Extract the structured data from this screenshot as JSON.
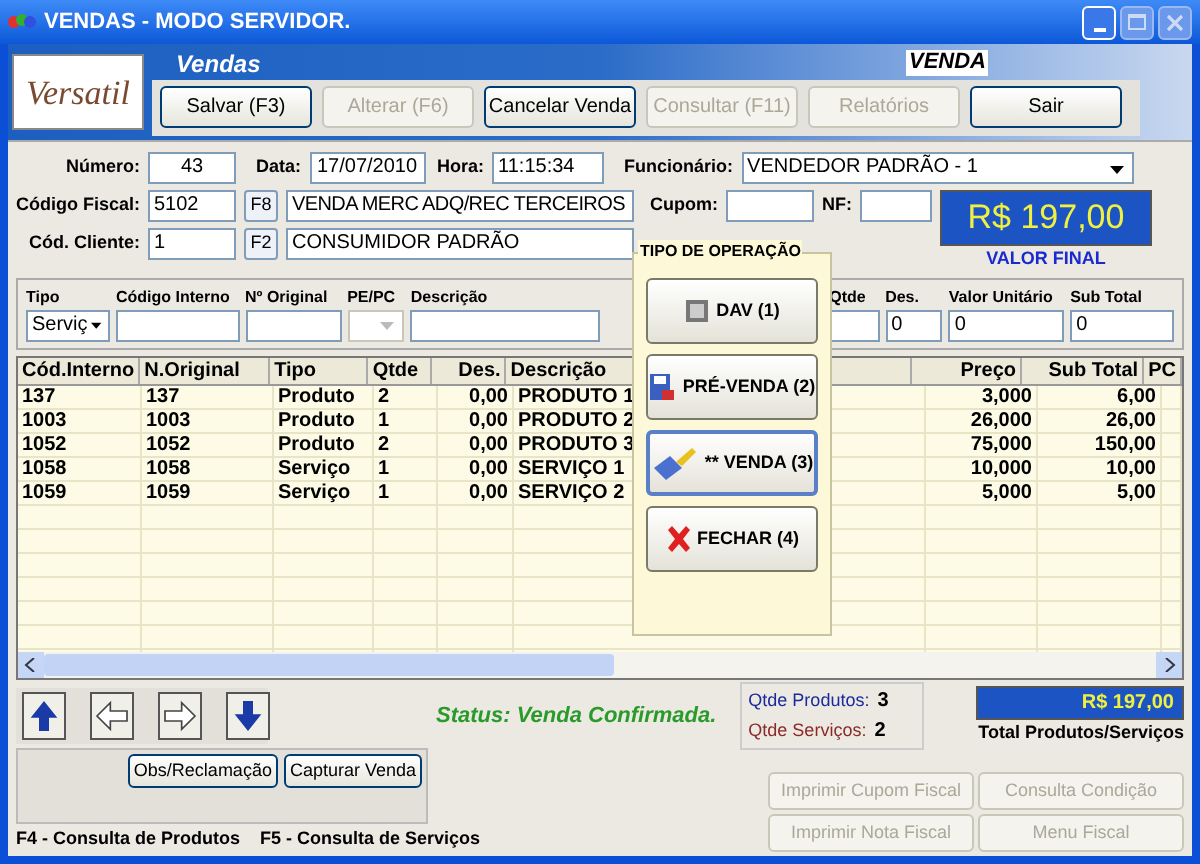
{
  "window": {
    "title": "VENDAS - MODO SERVIDOR."
  },
  "header": {
    "logo": "Versatil",
    "title": "Vendas",
    "mode": "VENDA"
  },
  "toolbar": {
    "buttons": [
      {
        "label": "Salvar (F3)",
        "disabled": false
      },
      {
        "label": "Alterar (F6)",
        "disabled": true
      },
      {
        "label": "Cancelar Venda",
        "disabled": false
      },
      {
        "label": "Consultar (F11)",
        "disabled": true
      },
      {
        "label": "Relatórios",
        "disabled": true
      },
      {
        "label": "Sair",
        "disabled": false
      }
    ]
  },
  "form": {
    "numero": {
      "label": "Número:",
      "value": "43"
    },
    "data": {
      "label": "Data:",
      "value": "17/07/2010"
    },
    "hora": {
      "label": "Hora:",
      "value": "11:15:34"
    },
    "funcionario": {
      "label": "Funcionário:",
      "value": "VENDEDOR PADRÃO - 1"
    },
    "codigo_fiscal": {
      "label": "Código Fiscal:",
      "value": "5102",
      "key": "F8",
      "description": "VENDA MERC ADQ/REC TERCEIROS"
    },
    "cupom": {
      "label": "Cupom:"
    },
    "nf": {
      "label": "NF:"
    },
    "cliente": {
      "label": "Cód. Cliente:",
      "value": "1",
      "key": "F2",
      "description": "CONSUMIDOR PADRÃO"
    },
    "valor_final": {
      "value": "R$ 197,00",
      "label": "VALOR FINAL"
    }
  },
  "entry": {
    "fields": [
      {
        "label": "Tipo",
        "value": "Serviç",
        "kind": "select",
        "disabled": false
      },
      {
        "label": "Código Interno",
        "kind": "input"
      },
      {
        "label": "Nº Original",
        "kind": "input"
      },
      {
        "label": "PE/PC",
        "kind": "select",
        "disabled": true
      },
      {
        "label": "Descrição",
        "kind": "input"
      },
      {
        "label": "Qtde",
        "kind": "input"
      },
      {
        "label": "Des.",
        "value": "0",
        "kind": "input"
      },
      {
        "label": "Valor Unitário",
        "value": "0",
        "kind": "input"
      },
      {
        "label": "Sub Total",
        "value": "0",
        "kind": "input"
      }
    ]
  },
  "table": {
    "columns": [
      "Cód.Interno",
      "N.Original",
      "Tipo",
      "Qtde",
      "Des.",
      "Descrição",
      "Preço",
      "Sub Total",
      "PC"
    ],
    "rows": [
      {
        "cells": [
          "137",
          "137",
          "Produto",
          "2",
          "0,00",
          "PRODUTO 1",
          "3,000",
          "6,00"
        ]
      },
      {
        "cells": [
          "1003",
          "1003",
          "Produto",
          "1",
          "0,00",
          "PRODUTO 2",
          "26,000",
          "26,00"
        ]
      },
      {
        "cells": [
          "1052",
          "1052",
          "Produto",
          "2",
          "0,00",
          "PRODUTO 3",
          "75,000",
          "150,00"
        ]
      },
      {
        "cells": [
          "1058",
          "1058",
          "Serviço",
          "1",
          "0,00",
          "SERVIÇO 1",
          "10,000",
          "10,00"
        ]
      },
      {
        "cells": [
          "1059",
          "1059",
          "Serviço",
          "1",
          "0,00",
          "SERVIÇO 2",
          "5,000",
          "5,00"
        ]
      }
    ]
  },
  "operation_dialog": {
    "title": "TIPO DE OPERAÇÃO",
    "buttons": [
      {
        "label": "DAV (1)",
        "kind": "document",
        "selected": false
      },
      {
        "label": "PRÉ-VENDA (2)",
        "kind": "floppy",
        "selected": false
      },
      {
        "label": "** VENDA (3)",
        "kind": "brush",
        "selected": true
      },
      {
        "label": "FECHAR (4)",
        "kind": "close",
        "selected": false
      }
    ]
  },
  "navigation": [
    {
      "kind": "up"
    },
    {
      "kind": "left"
    },
    {
      "kind": "right"
    },
    {
      "kind": "down"
    }
  ],
  "status": "Status: Venda Confirmada.",
  "counters": [
    {
      "label": "Qtde Produtos:",
      "value": "3",
      "color": "#1a2a9a"
    },
    {
      "label": "Qtde Serviços:",
      "value": "2",
      "color": "#8a2a2a"
    }
  ],
  "total": {
    "value": "R$ 197,00",
    "label": "Total Produtos/Serviços"
  },
  "actions": [
    {
      "label": "Obs/Reclamação",
      "disabled": false
    },
    {
      "label": "Capturar Venda",
      "disabled": false
    }
  ],
  "fiscal_buttons": [
    {
      "label": "Imprimir Cupom Fiscal",
      "disabled": true
    },
    {
      "label": "Consulta Condição",
      "disabled": true
    },
    {
      "label": "Imprimir Nota Fiscal",
      "disabled": true
    },
    {
      "label": "Menu Fiscal",
      "disabled": true
    }
  ],
  "shortcuts": [
    "F4 - Consulta de Produtos",
    "F5 - Consulta de Serviços"
  ]
}
